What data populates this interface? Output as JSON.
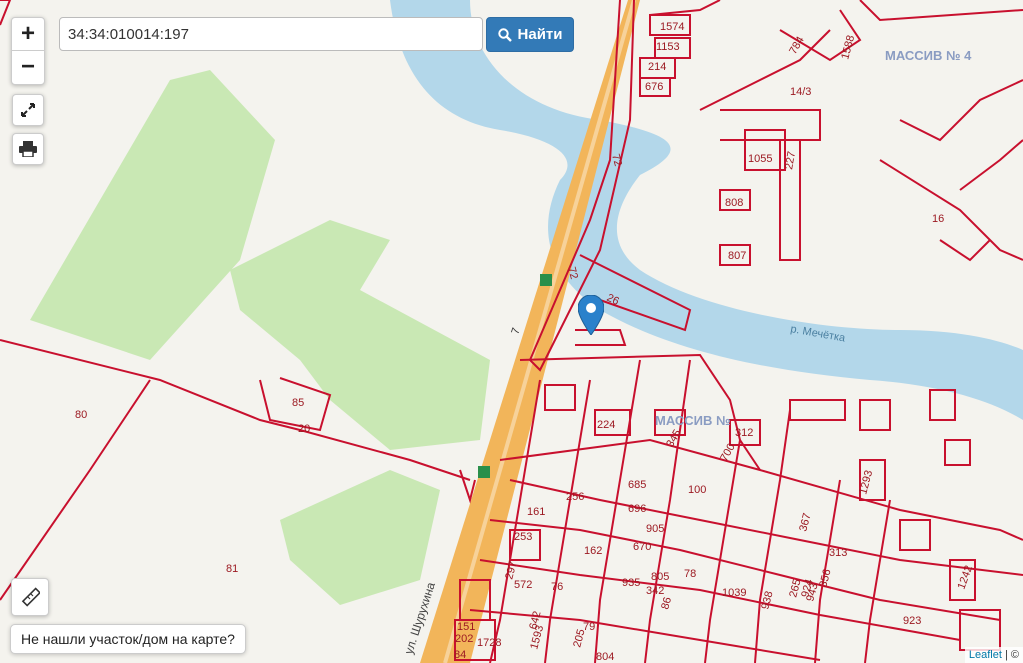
{
  "search": {
    "value": "34:34:010014:197",
    "button_label": "Найти"
  },
  "controls": {
    "zoom_in": "+",
    "zoom_out": "−"
  },
  "not_found_label": "Не нашли участок/дом на карте?",
  "attribution": {
    "link": "Leaflet",
    "suffix": "| ©"
  },
  "map_labels": {
    "river": "р. Мечётка",
    "street": "ул. Шурухина",
    "massif_1": "МАССИВ № 4",
    "massif_2": "МАССИВ №",
    "road_number": "7"
  },
  "parcel_labels": {
    "p80": "80",
    "p81": "81",
    "p20": "20",
    "p85": "85",
    "p72a": "72",
    "p72b": "72",
    "p26": "26",
    "p1574": "1574",
    "p1153": "1153",
    "p214": "214",
    "p676": "676",
    "p784": "784",
    "p1588": "1588",
    "p1413": "14/3",
    "p1055": "1055",
    "p227": "227",
    "p808": "808",
    "p807": "807",
    "p16": "16",
    "p224": "224",
    "p345": "345",
    "p312": "312",
    "p700": "700",
    "p685": "685",
    "p696": "696",
    "p100": "100",
    "p905": "905",
    "p670": "670",
    "p256": "256",
    "p161": "161",
    "p253": "253",
    "p162": "162",
    "p297": "297",
    "p572": "572",
    "p76": "76",
    "p935": "935",
    "p342": "342",
    "p805": "805",
    "p78": "78",
    "p1039": "1039",
    "p938": "938",
    "p265": "265",
    "p924": "924",
    "p356": "356",
    "p943": "943",
    "p313": "313",
    "p367": "367",
    "p1293": "1293",
    "p923": "923",
    "p1242": "1242",
    "p151": "151",
    "p202": "202",
    "p1728": "1728",
    "p84": "84",
    "p642": "642",
    "p1593": "1593",
    "p205": "205",
    "p79": "79",
    "p804": "804",
    "p86": "86"
  },
  "colors": {
    "parcel": "#c8102e",
    "water": "#b3d7ea",
    "green": "#c9e8b4",
    "road": "#f2b55a",
    "button": "#337ab7"
  }
}
